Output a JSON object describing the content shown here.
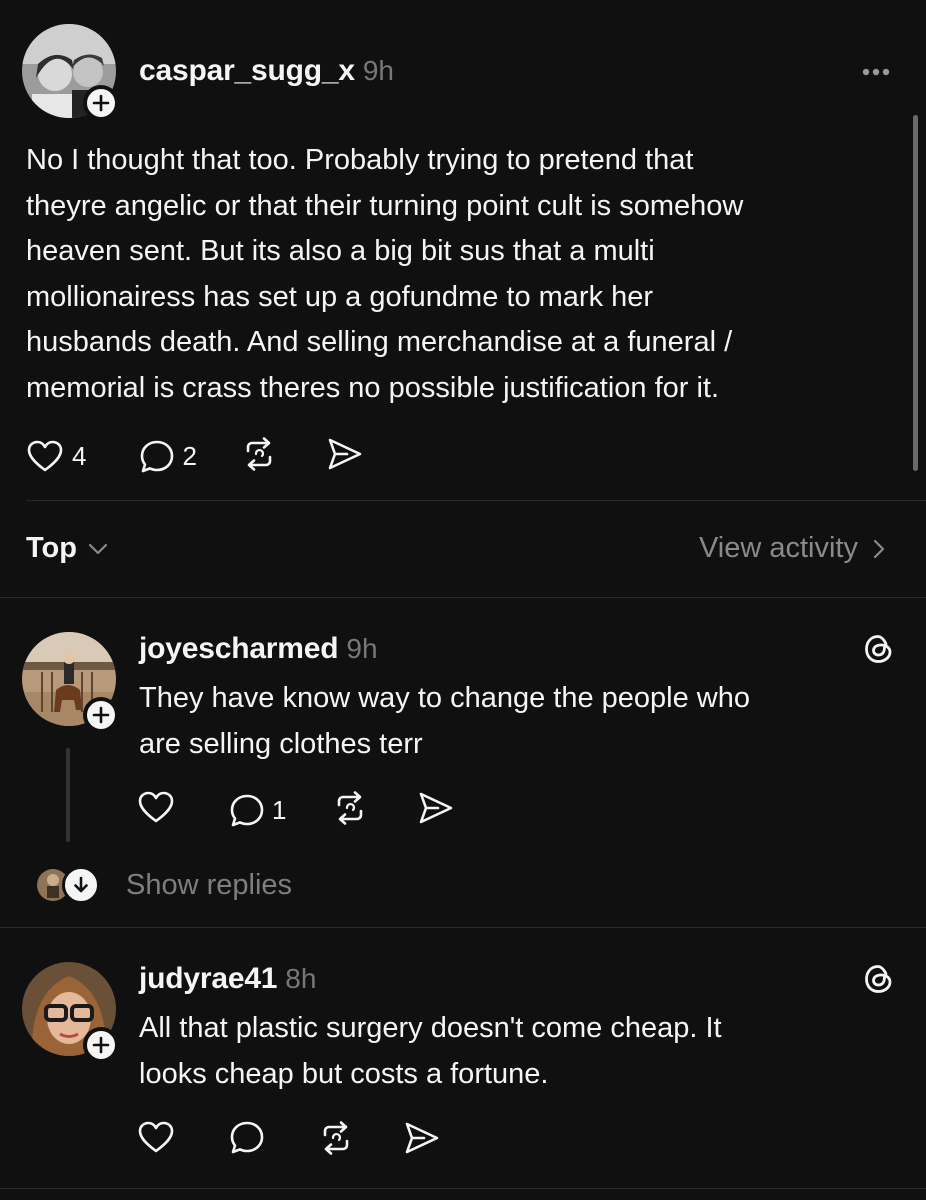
{
  "original_post": {
    "username": "caspar_sugg_x",
    "time": "9h",
    "text_lines": [
      "No I thought that too. Probably trying to pretend that",
      "theyre angelic or that their turning point cult is somehow",
      "heaven sent.  But its also a big bit sus that a multi",
      "mollionairess has set up a gofundme to mark her",
      "husbands death.  And selling merchandise at a funeral /",
      "memorial is crass theres no possible justification for it."
    ],
    "likes": "4",
    "comments": "2"
  },
  "sort_bar": {
    "sort_label": "Top",
    "view_activity_label": "View activity"
  },
  "replies": [
    {
      "username": "joyescharmed",
      "time": "9h",
      "text_lines": [
        "They have know way to change the people who",
        "are selling clothes terr"
      ],
      "likes": "",
      "comments": "1",
      "show_replies_label": "Show replies"
    },
    {
      "username": "judyrae41",
      "time": "8h",
      "text_lines": [
        "All that plastic surgery doesn't come cheap. It",
        "looks cheap but costs a fortune."
      ],
      "likes": "",
      "comments": ""
    }
  ],
  "colors": {
    "background": "#101010",
    "text": "#f3f5f7",
    "muted": "#777777",
    "divider": "#2a2a2a"
  },
  "icons": {
    "more": "more-horizontal-icon",
    "like": "heart-icon",
    "comment": "comment-bubble-icon",
    "repost": "repost-icon",
    "share": "send-icon",
    "threads": "threads-logo-icon",
    "follow": "plus-icon"
  }
}
